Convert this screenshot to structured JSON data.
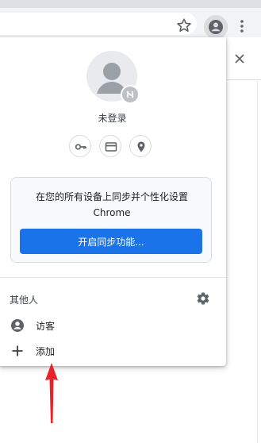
{
  "profile": {
    "status": "未登录"
  },
  "sync": {
    "line1": "在您的所有设备上同步并个性化设置",
    "line2": "Chrome",
    "button_label": "开启同步功能..."
  },
  "others": {
    "title": "其他人",
    "items": [
      {
        "label": "访客",
        "icon": "person-icon"
      },
      {
        "label": "添加",
        "icon": "plus-icon"
      }
    ]
  },
  "colors": {
    "accent": "#1a73e8",
    "annotation_arrow": "#e8242a"
  }
}
